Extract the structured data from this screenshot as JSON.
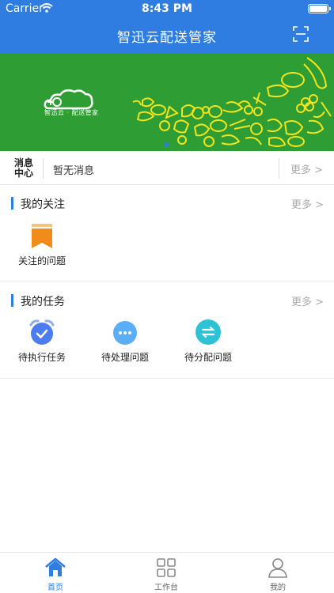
{
  "status_bar": {
    "carrier": "Carrier",
    "time": "8:43 PM"
  },
  "header": {
    "title": "智迅云配送管家",
    "scan_icon": "scan-icon"
  },
  "banner": {
    "logo_text": "智迅云 · 配送管家",
    "background": "#2e9d33",
    "active_slide": 1
  },
  "message_center": {
    "tag": "消息中心",
    "text": "暂无消息",
    "more_label": "更多 >"
  },
  "follow_section": {
    "title": "我的关注",
    "more_label": "更多 >",
    "items": [
      {
        "label": "关注的问题",
        "icon": "bookmark-icon"
      }
    ]
  },
  "task_section": {
    "title": "我的任务",
    "more_label": "更多 >",
    "items": [
      {
        "label": "待执行任务",
        "icon": "alarm-clock-icon"
      },
      {
        "label": "待处理问题",
        "icon": "more-dots-icon"
      },
      {
        "label": "待分配问题",
        "icon": "swap-arrows-icon"
      }
    ]
  },
  "tabbar": {
    "items": [
      {
        "label": "首页",
        "icon": "home-icon",
        "active": true
      },
      {
        "label": "工作台",
        "icon": "grid-icon",
        "active": false
      },
      {
        "label": "我的",
        "icon": "user-icon",
        "active": false
      }
    ]
  },
  "colors": {
    "primary": "#2f7de1",
    "banner_green": "#2e9d33",
    "accent_orange": "#f08c1a"
  }
}
